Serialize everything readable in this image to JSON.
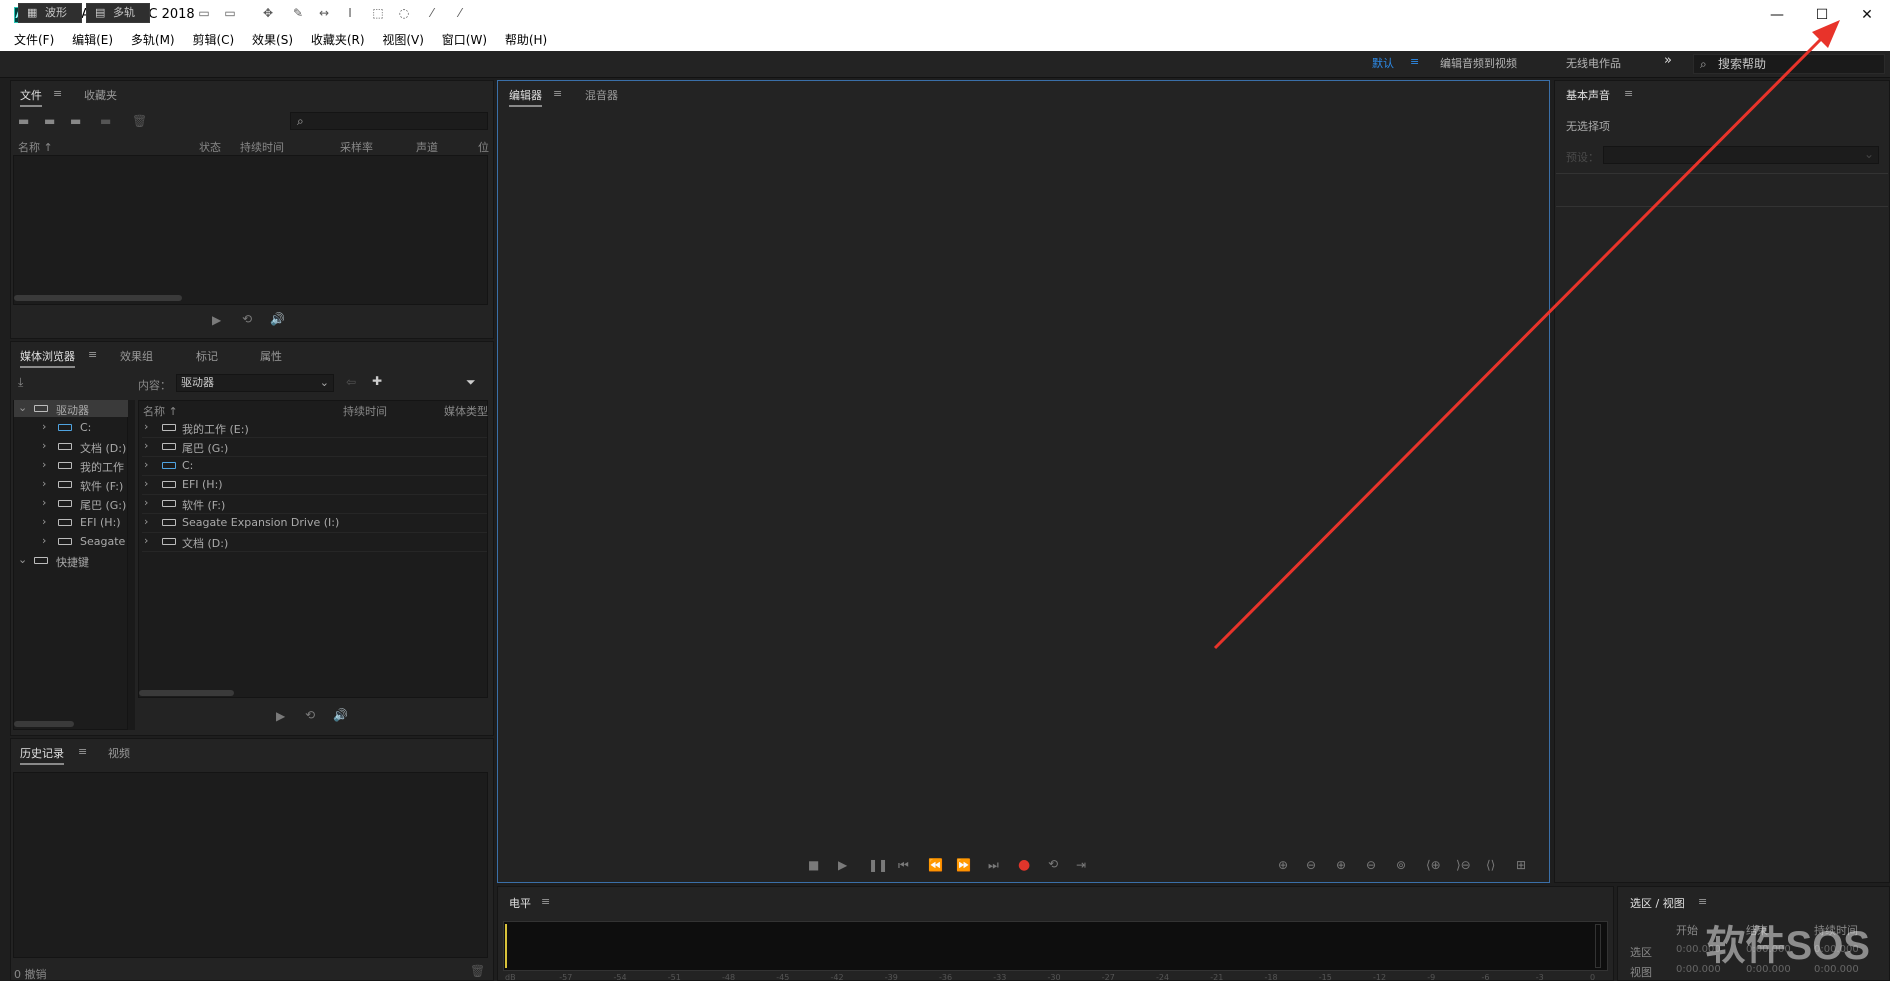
{
  "window": {
    "logo": "Au",
    "title": "Adobe Audition CC 2018",
    "minimize": "—",
    "maximize": "☐",
    "close": "✕"
  },
  "menu": [
    "文件(F)",
    "编辑(E)",
    "多轨(M)",
    "剪辑(C)",
    "效果(S)",
    "收藏夹(R)",
    "视图(V)",
    "窗口(W)",
    "帮助(H)"
  ],
  "toolbar": {
    "waveform": "波形",
    "multitrack": "多轨",
    "workspaces": [
      "默认",
      "编辑音频到视频",
      "无线电作品"
    ],
    "more": "»",
    "help_placeholder": "搜索帮助"
  },
  "files_panel": {
    "tabs": [
      "文件",
      "收藏夹"
    ],
    "columns": [
      "名称",
      "状态",
      "持续时间",
      "采样率",
      "声道",
      "位"
    ],
    "search_icon": "⌕"
  },
  "media_browser": {
    "tabs": [
      "媒体浏览器",
      "效果组",
      "标记",
      "属性"
    ],
    "content_label": "内容：",
    "content_value": "驱动器",
    "tree": [
      {
        "label": "驱动器",
        "type": "root"
      },
      {
        "label": "C:",
        "type": "sys"
      },
      {
        "label": "文档 (D:)",
        "type": "drive"
      },
      {
        "label": "我的工作",
        "type": "drive"
      },
      {
        "label": "软件 (F:)",
        "type": "drive"
      },
      {
        "label": "尾巴 (G:)",
        "type": "drive"
      },
      {
        "label": "EFI (H:)",
        "type": "drive"
      },
      {
        "label": "Seagate E",
        "type": "drive"
      },
      {
        "label": "快捷键",
        "type": "root"
      }
    ],
    "columns": [
      "名称",
      "持续时间",
      "媒体类型"
    ],
    "list": [
      {
        "label": "我的工作 (E:)",
        "type": "drive"
      },
      {
        "label": "尾巴 (G:)",
        "type": "drive"
      },
      {
        "label": "C:",
        "type": "sys"
      },
      {
        "label": "EFI (H:)",
        "type": "drive"
      },
      {
        "label": "软件 (F:)",
        "type": "drive"
      },
      {
        "label": "Seagate Expansion Drive (I:)",
        "type": "drive"
      },
      {
        "label": "文档 (D:)",
        "type": "drive"
      }
    ]
  },
  "history_panel": {
    "tabs": [
      "历史记录",
      "视频"
    ],
    "undo": "0 撤销"
  },
  "editor_panel": {
    "tabs": [
      "编辑器",
      "混音器"
    ]
  },
  "essential_sound": {
    "title": "基本声音",
    "no_selection": "无选择项",
    "preset_label": "预设："
  },
  "level_panel": {
    "title": "电平",
    "ticks": [
      "dB",
      "-57",
      "-54",
      "-51",
      "-48",
      "-45",
      "-42",
      "-39",
      "-36",
      "-33",
      "-30",
      "-27",
      "-24",
      "-21",
      "-18",
      "-15",
      "-12",
      "-9",
      "-6",
      "-3",
      "0"
    ]
  },
  "selection_view": {
    "title": "选区 / 视图",
    "headers": [
      "开始",
      "结束",
      "持续时间"
    ],
    "rows": [
      {
        "label": "选区",
        "values": [
          "0:00.000",
          "0:00.000",
          "0:00.000"
        ]
      },
      {
        "label": "视图",
        "values": [
          "0:00.000",
          "0:00.000",
          "0:00.000"
        ]
      }
    ]
  },
  "watermark": "软件SOS",
  "colors": {
    "accent": "#2d8ceb",
    "record": "#e0352b",
    "annotation_arrow": "#e8332a"
  }
}
